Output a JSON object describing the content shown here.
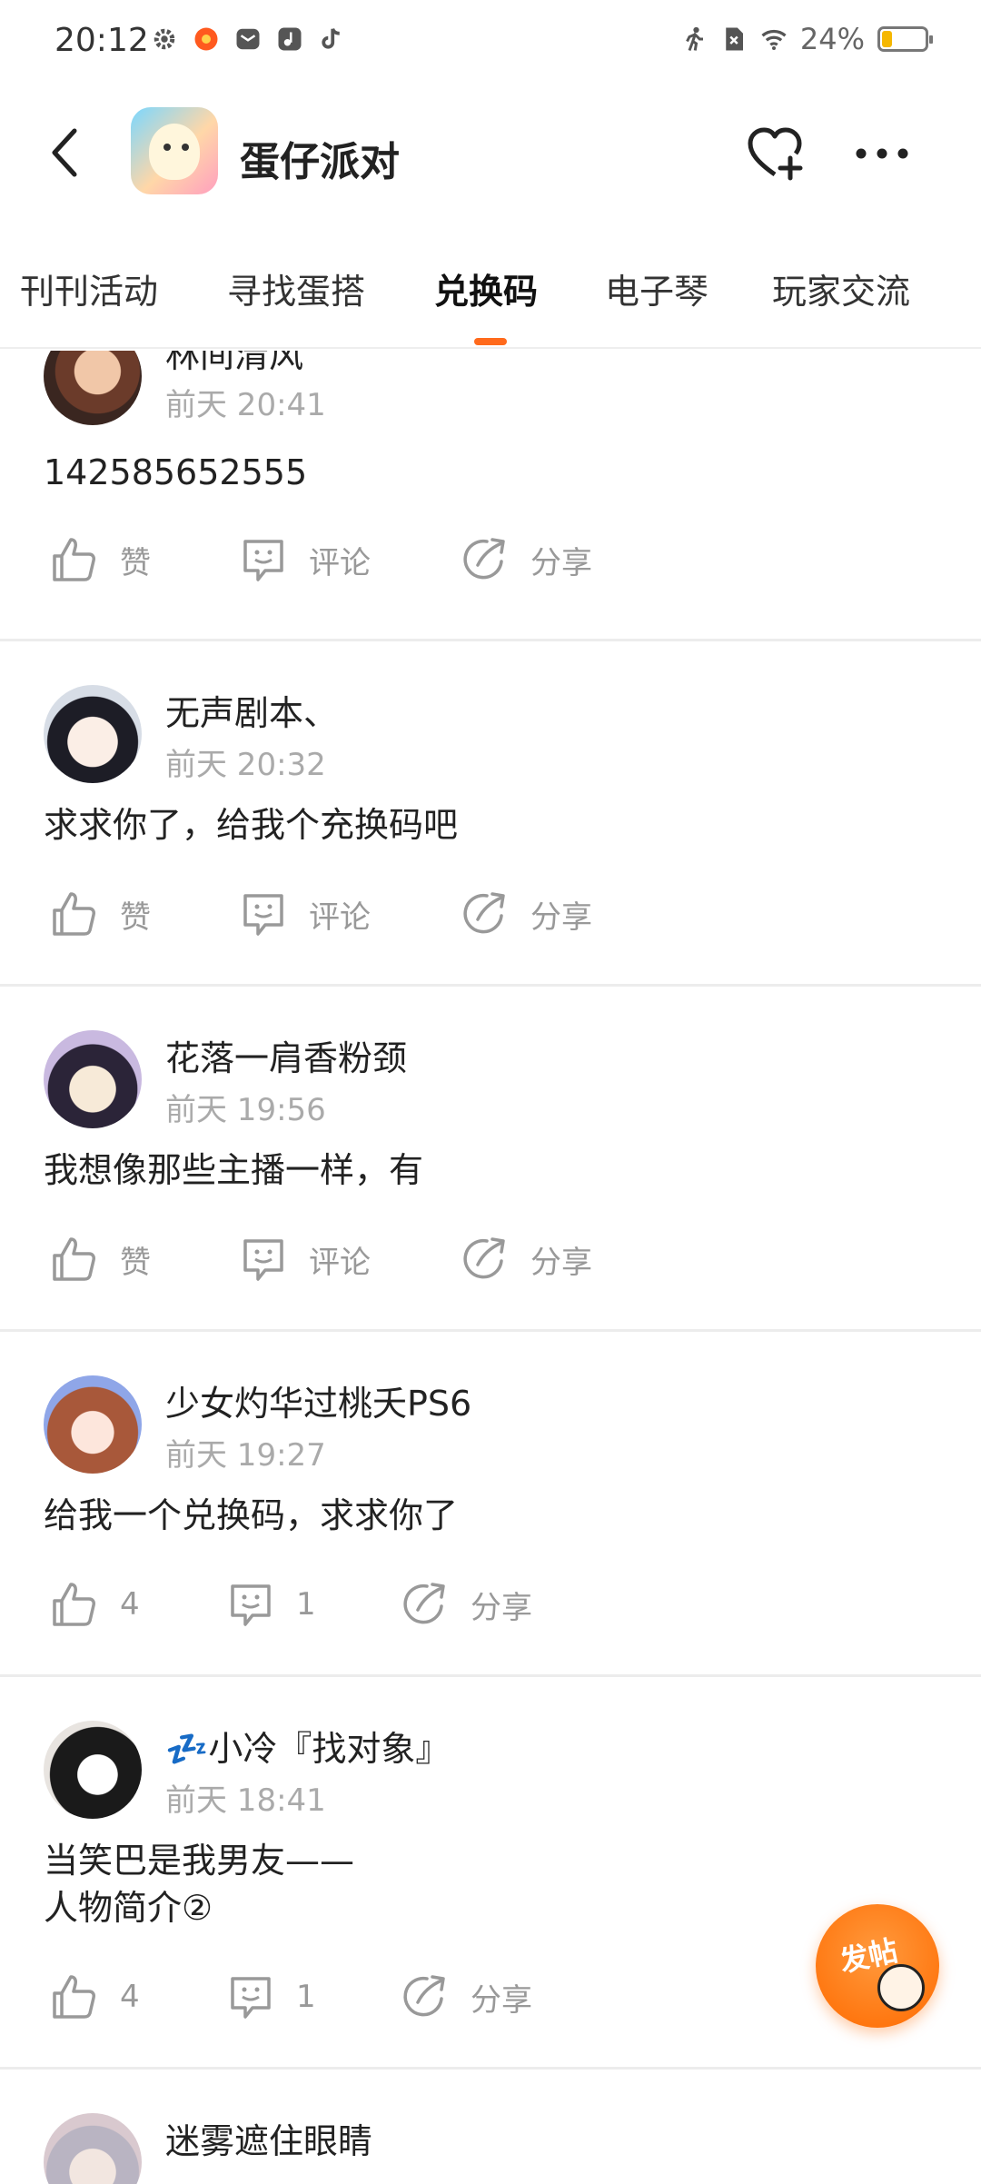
{
  "status_bar": {
    "time": "20:12",
    "battery_pct_label": "24%",
    "battery_level": 0.24
  },
  "header": {
    "title": "蛋仔派对"
  },
  "tabs": [
    {
      "label": "刊刊活动"
    },
    {
      "label": "寻找蛋搭"
    },
    {
      "label": "兑换码",
      "active": true
    },
    {
      "label": "电子琴"
    },
    {
      "label": "玩家交流"
    }
  ],
  "posts": [
    {
      "name": "林间清风",
      "time": "前天 20:41",
      "body": "142585652555",
      "like": "赞",
      "comment": "评论",
      "share": "分享"
    },
    {
      "name": "无声剧本、",
      "time": "前天 20:32",
      "body": "求求你了，给我个充换码吧",
      "like": "赞",
      "comment": "评论",
      "share": "分享"
    },
    {
      "name": "花落一肩香粉颈",
      "time": "前天 19:56",
      "body": "我想像那些主播一样，有",
      "like": "赞",
      "comment": "评论",
      "share": "分享"
    },
    {
      "name": "少女灼华过桃夭PS6",
      "time": "前天 19:27",
      "body": "给我一个兑换码，求求你了",
      "like": "4",
      "comment": "1",
      "share": "分享"
    },
    {
      "name": "💤小冷『找对象』",
      "time": "前天 18:41",
      "body": "当笑巴是我男友——\n人物简介②",
      "like": "4",
      "comment": "1",
      "share": "分享"
    },
    {
      "name": "迷雾遮住眼睛",
      "time": "",
      "body": "",
      "like": "",
      "comment": "",
      "share": ""
    }
  ],
  "fab": {
    "label": "发帖"
  },
  "colors": {
    "accent": "#ff6a1c",
    "meta_text": "#aaaaaa",
    "divider": "#ececec"
  }
}
